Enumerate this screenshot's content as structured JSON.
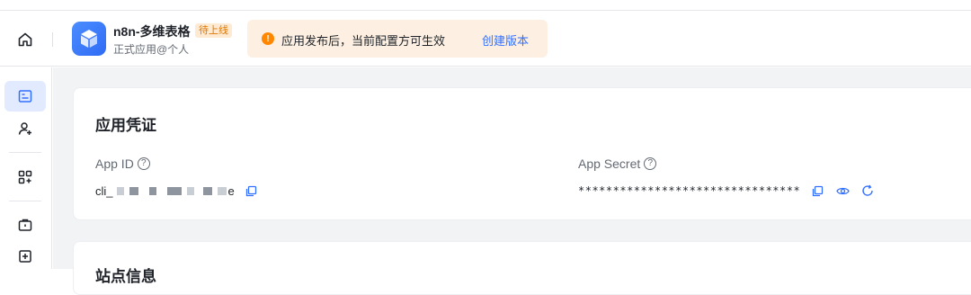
{
  "header": {
    "app_name": "n8n-多维表格",
    "app_badge": "待上线",
    "app_subtitle": "正式应用@个人"
  },
  "notice": {
    "text": "应用发布后，当前配置方可生效",
    "link": "创建版本",
    "icon": "!"
  },
  "credentials": {
    "title": "应用凭证",
    "app_id_label": "App ID",
    "app_id_prefix": "cli_",
    "app_id_suffix": "e",
    "app_secret_label": "App Secret",
    "app_secret_value": "********************************"
  },
  "next_section": {
    "title": "站点信息"
  },
  "colors": {
    "accent": "#3370ff",
    "warning": "#ff8800",
    "notice_bg": "#fdf0e2",
    "active_nav_bg": "#e1eaff"
  }
}
